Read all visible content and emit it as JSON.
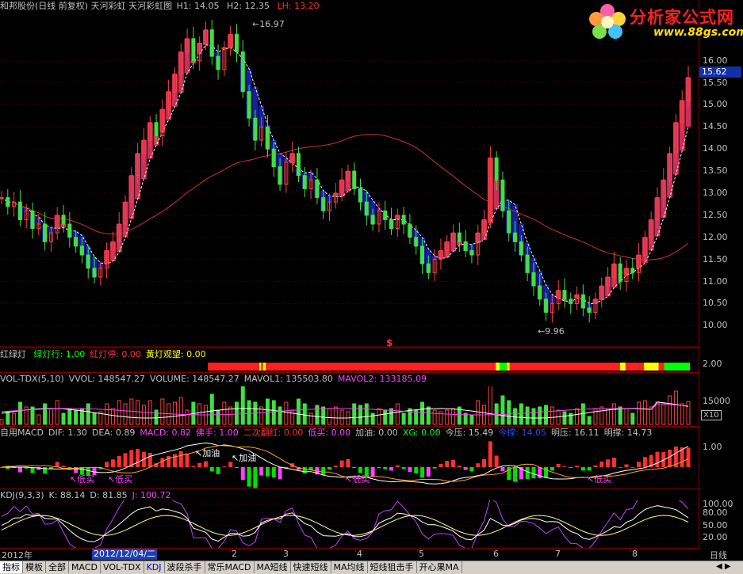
{
  "header": {
    "title": "和邦股份(日线 前复权) 天河彩虹  天河彩虹图",
    "h1": "H1: 14.05",
    "h2": "H2: 12.35",
    "lh": "LH: 13.20"
  },
  "logo": {
    "text": "分析家公式网",
    "url": "www.88gs.com"
  },
  "price_tag": "15.62",
  "annotations": {
    "high": "16.97",
    "low": "9.96",
    "marker": "$"
  },
  "price_axis_ticks": [
    "16.00",
    "15.50",
    "15.00",
    "14.50",
    "14.00",
    "13.50",
    "13.00",
    "12.50",
    "12.00",
    "11.50",
    "11.00",
    "10.50",
    "10.00"
  ],
  "light_panel": {
    "title": "红绿灯",
    "items": [
      {
        "label": "绿灯行: 1.00",
        "color": "#00ff00"
      },
      {
        "label": "红灯停: 0.00",
        "color": "#ff3030"
      },
      {
        "label": "黃灯观望: 0.00",
        "color": "#ffff00"
      }
    ],
    "axis": "2.00",
    "segments": [
      {
        "c": "#ff2020",
        "n": 56
      },
      {
        "c": "#ffff00",
        "n": 2
      },
      {
        "c": "#ff2020",
        "n": 2
      },
      {
        "c": "#ffff00",
        "n": 3
      },
      {
        "c": "#ff2020",
        "n": 250
      },
      {
        "c": "#ffff00",
        "n": 4
      },
      {
        "c": "#00ff00",
        "n": 8
      },
      {
        "c": "#ffff00",
        "n": 3
      },
      {
        "c": "#ff2020",
        "n": 120
      },
      {
        "c": "#ffff00",
        "n": 6
      },
      {
        "c": "#ff2020",
        "n": 20
      },
      {
        "c": "#ffff00",
        "n": 16
      },
      {
        "c": "#ff2020",
        "n": 6
      },
      {
        "c": "#00ff00",
        "n": 28
      }
    ]
  },
  "vol_panel": {
    "items": [
      {
        "label": "VOL-TDX(5,10)",
        "color": "#c0c0c0"
      },
      {
        "label": "VVOL: 148547.27",
        "color": "#c0c0c0"
      },
      {
        "label": "VOLUME: 148547.27",
        "color": "#c0c0c0"
      },
      {
        "label": "MAVOL1: 135503.80",
        "color": "#c0c0c0"
      },
      {
        "label": "MAVOL2: 133185.09",
        "color": "#ff40ff"
      }
    ],
    "axis": "15000",
    "unit": "X10"
  },
  "macd_panel": {
    "items": [
      {
        "label": "自用MACD",
        "color": "#c0c0c0"
      },
      {
        "label": "DIF: 1.30",
        "color": "#c0c0c0"
      },
      {
        "label": "DEA: 0.89",
        "color": "#c0c0c0"
      },
      {
        "label": "MACD: 0.82",
        "color": "#ff40ff"
      },
      {
        "label": "佛手: 1.00",
        "color": "#ff40ff"
      },
      {
        "label": "二次翻红: 0.00",
        "color": "#ff3030"
      },
      {
        "label": "低买: 0.00",
        "color": "#ff40ff"
      },
      {
        "label": "加油: 0.00",
        "color": "#c0c0c0"
      },
      {
        "label": "XG: 0.00",
        "color": "#00ff00"
      },
      {
        "label": "今压: 15.49",
        "color": "#c0c0c0"
      },
      {
        "label": "今撑: 14.05",
        "color": "#1e50ff"
      },
      {
        "label": "明压: 16.11",
        "color": "#c0c0c0"
      },
      {
        "label": "明撑: 14.73",
        "color": "#c0c0c0"
      }
    ],
    "axis_top": "1.00",
    "axis_mid": "0.00",
    "labels": {
      "jiayou": "加油",
      "dimai": "低买"
    }
  },
  "kdj_panel": {
    "items": [
      {
        "label": "KDJ(9,3,3)",
        "color": "#c0c0c0"
      },
      {
        "label": "K: 88.14",
        "color": "#c0c0c0"
      },
      {
        "label": "D: 81.85",
        "color": "#c0c0c0"
      },
      {
        "label": "J: 100.72",
        "color": "#ff40ff"
      }
    ],
    "axis": [
      "100.00",
      "80.00",
      "50.00",
      "20.00"
    ]
  },
  "date_axis": {
    "year": "2012年",
    "selected": "2012/12/04/二",
    "months": [
      "2",
      "3",
      "4",
      "5",
      "6",
      "7",
      "8"
    ],
    "period": "日线"
  },
  "toolbar": {
    "tabs": [
      "指标",
      "模板",
      "全部",
      "MACD",
      "VOL-TDX",
      "KDJ",
      "波段杀手",
      "常乐MACD",
      "MA短线",
      "快速短线",
      "MA均线",
      "短线狙击手",
      "开心果MA"
    ]
  },
  "chart_data": {
    "type": "candlestick",
    "title": "和邦股份(日线 前复权) 天河彩虹  天河彩虹图",
    "ylim": [
      9.7,
      16.3
    ],
    "high": 16.97,
    "low": 9.96,
    "last": 15.62,
    "close": [
      12.9,
      12.7,
      12.8,
      12.4,
      12.6,
      12.2,
      12.3,
      11.9,
      12.1,
      12.5,
      12.3,
      12.0,
      11.8,
      11.6,
      11.3,
      11.1,
      11.3,
      11.7,
      11.9,
      12.3,
      12.8,
      13.4,
      13.9,
      14.2,
      14.6,
      14.3,
      14.9,
      15.3,
      15.7,
      16.2,
      16.5,
      16.0,
      16.4,
      16.7,
      16.1,
      15.8,
      16.3,
      16.6,
      16.2,
      15.3,
      14.7,
      14.2,
      14.5,
      14.0,
      13.6,
      13.2,
      13.7,
      13.9,
      13.4,
      13.1,
      13.3,
      12.9,
      12.6,
      12.8,
      13.0,
      13.3,
      13.5,
      13.1,
      12.8,
      12.5,
      12.3,
      12.6,
      12.4,
      12.2,
      12.5,
      12.3,
      12.0,
      11.8,
      11.4,
      11.2,
      11.5,
      11.7,
      11.9,
      12.1,
      11.9,
      11.7,
      11.6,
      12.1,
      12.4,
      13.8,
      13.3,
      12.6,
      12.1,
      11.9,
      11.6,
      11.2,
      10.9,
      10.6,
      10.3,
      10.5,
      10.8,
      10.6,
      10.5,
      10.7,
      10.4,
      10.3,
      10.6,
      10.9,
      11.1,
      11.4,
      11.0,
      11.3,
      11.2,
      11.6,
      12.0,
      12.4,
      12.9,
      13.3,
      13.9,
      14.6,
      15.1,
      15.62
    ]
  }
}
